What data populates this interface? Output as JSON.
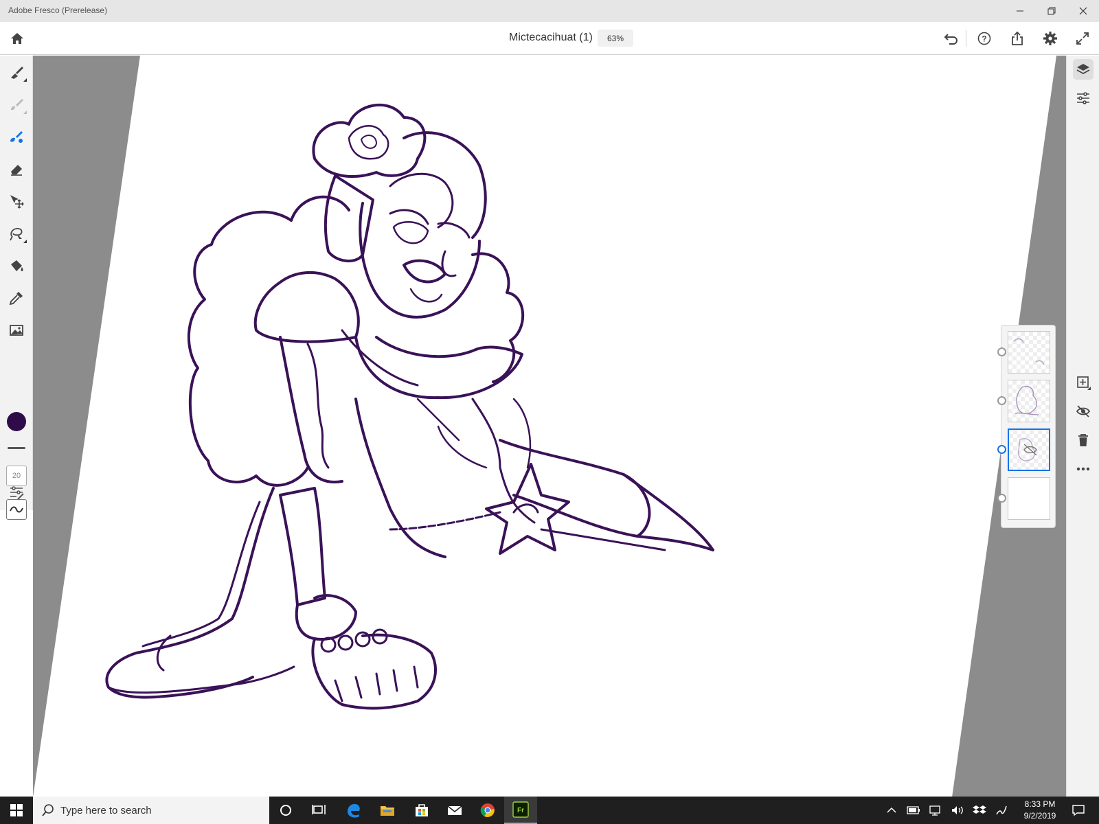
{
  "window": {
    "title": "Adobe Fresco (Prerelease)",
    "controls": [
      "minimize",
      "restore",
      "close"
    ]
  },
  "header": {
    "document_title": "Mictecacihuat (1)",
    "zoom": "63%",
    "right_buttons": [
      "undo-icon",
      "help-icon",
      "share-icon",
      "settings-icon",
      "fullscreen-icon"
    ]
  },
  "left_toolbar": {
    "tools": [
      "pixel-brush-icon",
      "live-brush-icon",
      "vector-brush-icon",
      "eraser-icon",
      "transform-icon",
      "lasso-select-icon",
      "fill-icon",
      "eyedropper-icon",
      "place-image-icon"
    ],
    "current_color": "#2e0c4a",
    "brush_size": "20"
  },
  "right_panel": {
    "tools": [
      "layers-icon",
      "layer-properties-icon"
    ],
    "layer_actions": [
      "add-layer-icon",
      "hide-layer-icon",
      "delete-layer-icon",
      "more-icon"
    ],
    "layer_count": 4,
    "selected_layer_index": 2
  },
  "canvas": {
    "artwork": "purple line-art illustration of a seated figure with rose headdress",
    "line_color": "#3a1257"
  },
  "taskbar": {
    "search_placeholder": "Type here to search",
    "apps": [
      "cortana-icon",
      "task-view-icon",
      "edge-icon",
      "file-explorer-icon",
      "store-icon",
      "mail-icon",
      "chrome-icon",
      "fresco-icon"
    ],
    "fresco_label": "Fr",
    "time": "8:33 PM",
    "date": "9/2/2019"
  }
}
